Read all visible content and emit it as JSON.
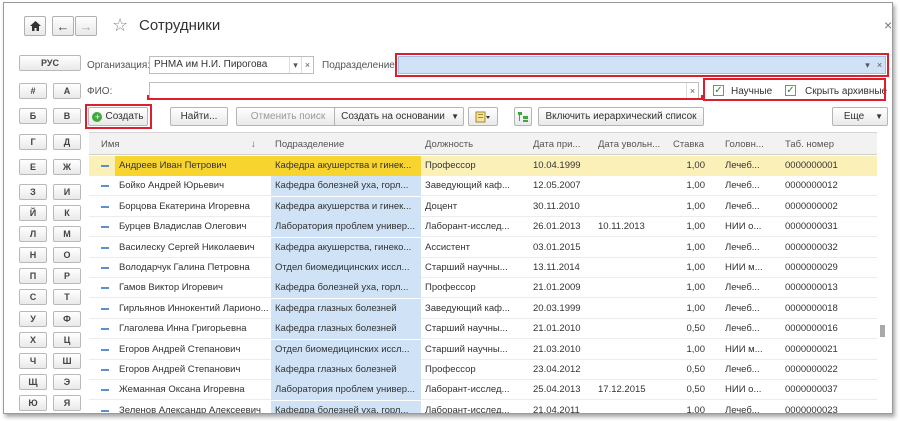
{
  "window": {
    "title": "Сотрудники",
    "home_icon": "home-icon",
    "back_icon": "arrow-left-icon",
    "forward_icon": "arrow-right-icon",
    "fav_icon": "star-icon",
    "close": "×"
  },
  "alphabet": {
    "lang_button": "РУС",
    "rows": [
      [
        "#",
        "А"
      ],
      [
        "Б",
        "В"
      ],
      [
        "Г",
        "Д"
      ],
      [
        "Е",
        "Ж"
      ],
      [
        "З",
        "И"
      ],
      [
        "Й",
        "К"
      ],
      [
        "Л",
        "М"
      ],
      [
        "Н",
        "О"
      ],
      [
        "П",
        "Р"
      ],
      [
        "С",
        "Т"
      ],
      [
        "У",
        "Ф"
      ],
      [
        "Х",
        "Ц"
      ],
      [
        "Ч",
        "Ш"
      ],
      [
        "Щ",
        "Э"
      ],
      [
        "Ю",
        "Я"
      ]
    ]
  },
  "filters": {
    "org_label": "Организация:",
    "org_value": "РНМА им Н.И. Пирогова",
    "dept_label": "Подразделение:",
    "dept_value": "",
    "fio_label": "ФИО:",
    "fio_value": "",
    "check_scientific": "Научные",
    "check_hide_archive": "Скрыть архивные",
    "dropdown_glyph": "▾",
    "clear_glyph": "×"
  },
  "toolbar": {
    "create": "Создать",
    "find": "Найти...",
    "cancel_search": "Отменить поиск",
    "create_based": "Создать на основании",
    "hierarchy": "Включить иерархический список",
    "more": "Еще"
  },
  "table": {
    "columns": [
      "Имя",
      "Подразделение",
      "Должность",
      "Дата при...",
      "Дата увольн...",
      "Ставка",
      "Головн...",
      "Таб. номер"
    ],
    "sort_glyph": "↓",
    "rows": [
      [
        "Андреев Иван Петрович",
        "Кафедра акушерства и гинек...",
        "Профессор",
        "10.04.1999",
        "",
        "1,00",
        "Лечеб...",
        "0000000001"
      ],
      [
        "Бойко Андрей Юрьевич",
        "Кафедра болезней уха, горл...",
        "Заведующий каф...",
        "12.05.2007",
        "",
        "1,00",
        "Лечеб...",
        "0000000012"
      ],
      [
        "Борцова Екатерина Игоревна",
        "Кафедра акушерства и гинек...",
        "Доцент",
        "30.11.2010",
        "",
        "1,00",
        "Лечеб...",
        "0000000002"
      ],
      [
        "Бурцев Владислав Олегович",
        "Лаборатория проблем универ...",
        "Лаборант-исслед...",
        "26.01.2013",
        "10.11.2013",
        "1,00",
        "НИИ о...",
        "0000000031"
      ],
      [
        "Василеску Сергей Николаевич",
        "Кафедра акушерства, гинеко...",
        "Ассистент",
        "03.01.2015",
        "",
        "1,00",
        "Лечеб...",
        "0000000032"
      ],
      [
        "Володарчук Галина Петровна",
        "Отдел биомедицинских иссл...",
        "Старший научны...",
        "13.11.2014",
        "",
        "1,00",
        "НИИ м...",
        "0000000029"
      ],
      [
        "Гамов Виктор Игоревич",
        "Кафедра болезней уха, горл...",
        "Профессор",
        "21.01.2009",
        "",
        "1,00",
        "Лечеб...",
        "0000000013"
      ],
      [
        "Гирльянов Иннокентий Ларионо...",
        "Кафедра глазных болезней",
        "Заведующий каф...",
        "20.03.1999",
        "",
        "1,00",
        "Лечеб...",
        "0000000018"
      ],
      [
        "Глаголева Инна Григорьевна",
        "Кафедра глазных болезней",
        "Старший научны...",
        "21.01.2010",
        "",
        "0,50",
        "Лечеб...",
        "0000000016"
      ],
      [
        "Егоров Андрей Степанович",
        "Отдел биомедицинских иссл...",
        "Старший научны...",
        "21.03.2010",
        "",
        "1,00",
        "НИИ м...",
        "0000000021"
      ],
      [
        "Егоров Андрей Степанович",
        "Кафедра глазных болезней",
        "Профессор",
        "23.04.2012",
        "",
        "0,50",
        "Лечеб...",
        "0000000022"
      ],
      [
        "Жеманная Оксана Игоревна",
        "Лаборатория проблем универ...",
        "Лаборант-исслед...",
        "25.04.2013",
        "17.12.2015",
        "0,50",
        "НИИ о...",
        "0000000037"
      ],
      [
        "Зеленов Александр Алексеевич",
        "Кафедра болезней уха, горл...",
        "Лаборант-исслед...",
        "21.04.2011",
        "",
        "1,00",
        "Лечеб...",
        "0000000023"
      ]
    ],
    "selected_row": 0
  }
}
